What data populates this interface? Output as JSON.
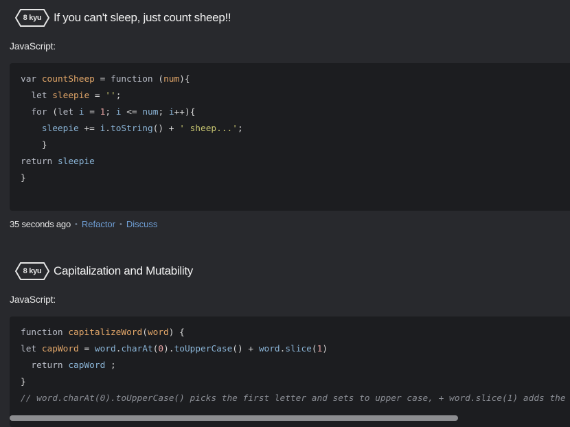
{
  "katas": [
    {
      "rank": "8 kyu",
      "title": "If you can't sleep, just count sheep!!",
      "language": "JavaScript:",
      "code_lines": [
        "var countSheep = function (num){",
        "  let sleepie = '';",
        "  for (let i = 1; i <= num; i++){",
        "    sleepie += i.toString() + ' sheep...';",
        "    }",
        "return sleepie",
        "}"
      ],
      "meta": {
        "time": "35 seconds ago",
        "separator": "•",
        "refactor": "Refactor",
        "discuss": "Discuss"
      }
    },
    {
      "rank": "8 kyu",
      "title": "Capitalization and Mutability",
      "language": "JavaScript:",
      "code_lines": [
        "function capitalizeWord(word) {",
        "let capWord = word.charAt(0).toUpperCase() + word.slice(1)",
        "  return capWord ;",
        "}",
        "// word.charAt(0).toUpperCase() picks the first letter and sets to upper case, + word.slice(1) adds the"
      ]
    }
  ],
  "colors": {
    "background": "#28292d",
    "code_background": "#1c1d20",
    "link": "#6f9fd6",
    "keyword": "#b9bdc7",
    "function_name": "#e3a769",
    "variable": "#8ab4d6",
    "string": "#c9c771",
    "number": "#e5a2a2",
    "comment": "#8a8d94"
  },
  "scroll": {
    "horizontal_position": 0.0,
    "visible_fraction": 0.8
  }
}
